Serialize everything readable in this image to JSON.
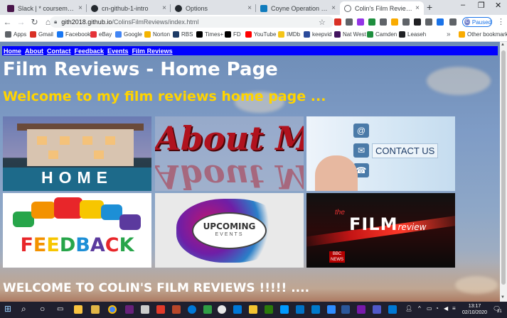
{
  "browser": {
    "tabs": [
      {
        "title": "Slack | * coursematerials | Cod",
        "favicon_color": "#4a154b",
        "active": false
      },
      {
        "title": "cn-github-1-intro",
        "favicon_color": "#24292e",
        "active": false
      },
      {
        "title": "Options",
        "favicon_color": "#24292e",
        "active": false
      },
      {
        "title": "Coyne Operation Website Proj",
        "favicon_color": "#0f7bbd",
        "active": false
      },
      {
        "title": "Colin's Film Reviews",
        "favicon_color": "#5f6368",
        "active": true
      }
    ],
    "new_tab_glyph": "+",
    "tab_close_glyph": "×",
    "window_controls": [
      "–",
      "❐",
      "✕"
    ],
    "url_host": "gith2018.github.io",
    "url_path": "/ColinsFilmReviews/index.html",
    "profile_status": "Paused",
    "profile_initial": "C",
    "extension_colors": [
      "#d93025",
      "#5f6368",
      "#9334e6",
      "#1e8e3e",
      "#5f6368",
      "#f9ab00",
      "#5f6368",
      "#202124",
      "#5f6368",
      "#1a73e8",
      "#5f6368"
    ]
  },
  "bookmarks": {
    "items": [
      {
        "label": "Apps",
        "color": "#5f6368"
      },
      {
        "label": "Gmail",
        "color": "#d93025"
      },
      {
        "label": "Facebook",
        "color": "#1877f2"
      },
      {
        "label": "eBay",
        "color": "#e53238"
      },
      {
        "label": "Google",
        "color": "#4285f4"
      },
      {
        "label": "Norton",
        "color": "#f4b400"
      },
      {
        "label": "RBS",
        "color": "#1d3b66"
      },
      {
        "label": "Times+",
        "color": "#000000"
      },
      {
        "label": "FD",
        "color": "#000000"
      },
      {
        "label": "YouTube",
        "color": "#ff0000"
      },
      {
        "label": "IMDb",
        "color": "#f5c518"
      },
      {
        "label": "keepvid",
        "color": "#2b4b9b"
      },
      {
        "label": "Nat West",
        "color": "#42145f"
      },
      {
        "label": "Camden",
        "color": "#1e8e3e"
      },
      {
        "label": "Leaseh",
        "color": "#202124"
      }
    ],
    "more_glyph": "»",
    "other_bookmarks": "Other bookmarks"
  },
  "page": {
    "nav_links": [
      "Home",
      "About",
      "Contact",
      "Feedback",
      "Events",
      "Film Reviews"
    ],
    "title": "Film Reviews - Home Page",
    "welcome": "Welcome to my film reviews home page ...",
    "tiles": {
      "home": "HOME",
      "about": "About Me",
      "contact": "CONTACT US",
      "feedback": "FEEDBACK",
      "events_main": "UPCOMING",
      "events_sub": "EVENTS",
      "film_the": "the",
      "film_main": "FILM",
      "film_sub": "review",
      "film_badge": "BBC NEWS"
    },
    "welcome_footer": "WELCOME TO COLIN'S FILM REVIEWS !!!!! ...."
  },
  "colors": {
    "nav_bar": "#0000ff",
    "title": "#ffffff",
    "welcome": "#ffd400",
    "feedback_letters": [
      "#e8262a",
      "#f39200",
      "#f7c600",
      "#27a54a",
      "#1d8fd6",
      "#5b3a9e",
      "#e8262a",
      "#27a54a"
    ]
  },
  "taskbar": {
    "time": "13:17",
    "date": "02/10/2020",
    "search_glyph": "⌕",
    "notification_count": "21"
  }
}
